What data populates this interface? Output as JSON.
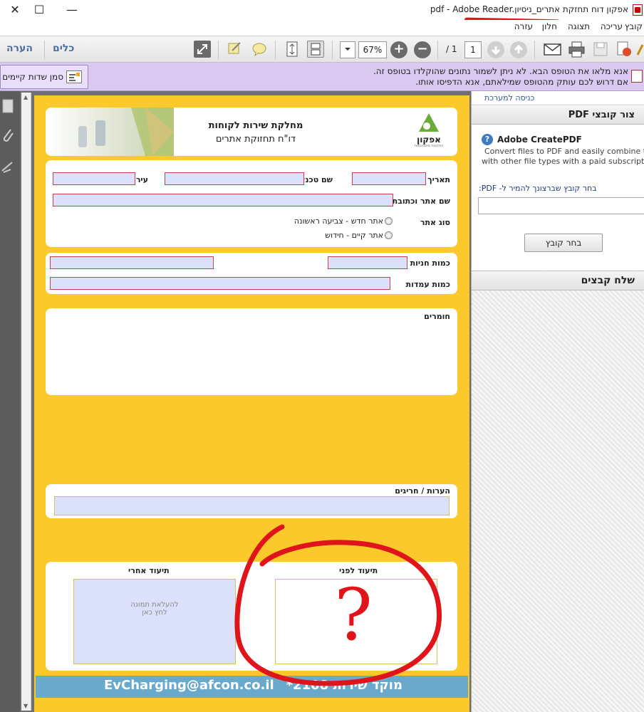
{
  "window": {
    "title": "pdf - Adobe Reader.אפקון דוח תחזקת אתרים_ניסיון",
    "controls": [
      "✕",
      "☐",
      "—"
    ]
  },
  "menu": {
    "items": [
      "קובץ",
      "עריכה",
      "תצוגה",
      "חלון",
      "עזרה"
    ]
  },
  "toolbar": {
    "comment_label": "הערה",
    "tools_label": "כלים",
    "zoom_value": "67%",
    "page_current": "1",
    "page_total": "/ 1"
  },
  "notice": {
    "line1": "אנא מלאו את הטופס הבא. לא ניתן לשמור נתונים שהוקלדו בטופס זה.",
    "line2": "אם דרוש לכם עותק מהטופס שמילאתם, אנא הדפיסו אותו.",
    "highlight_button": "סמן שדות קיימים"
  },
  "form": {
    "header_title": "מחלקת שירות לקוחות",
    "header_subtitle": "דו\"ח תחזוקת אתרים",
    "logo_text": "אפקון",
    "logo_subtext": "התקנות מתוחכמות",
    "fields": {
      "date_label": "תאריך",
      "technician_label": "שם טכנאי",
      "city_label": "עיר",
      "site_label": "שם אתר וכתובת",
      "site_type_label": "סוג אתר",
      "radio_new": "אתר חדש - צביעה ראשונה",
      "radio_existing": "אתר קיים - חידוש",
      "stores_label": "כמות חניות",
      "stations_label": "כמות עמדות",
      "materials_label": "חומרים",
      "notes_label": "הערות / חריגים",
      "before_label": "תיעוד לפני",
      "after_label": "תיעוד אחרי",
      "upload_line1": "להעלאת תמונה",
      "upload_line2": "לחץ כאן"
    },
    "footer_hotline": "מוקד שירות 2108*",
    "footer_email": "EvCharging@afcon.co.il",
    "annotation": "?"
  },
  "rightpane": {
    "signin_link": "כניסה למערכת",
    "create_header": "צור קובצי PDF",
    "createpdf_title": "Adobe CreatePDF",
    "createpdf_desc1": "Convert files to PDF and easily combine them",
    "createpdf_desc2": "with other file types with a paid subscriptio.",
    "choose_prompt": "בחר קובץ שברצונך להמיר ל- PDF:",
    "choose_button": "בחר קובץ",
    "send_header": "שלח קבצים"
  },
  "colors": {
    "form_yellow": "#fbc92b",
    "field_fill": "#dbe0fb",
    "field_border": "#c9404a",
    "notice_purple": "#d9c8f0",
    "annotation_red": "#e0141b",
    "footer_blue": "#6ba9cc"
  }
}
